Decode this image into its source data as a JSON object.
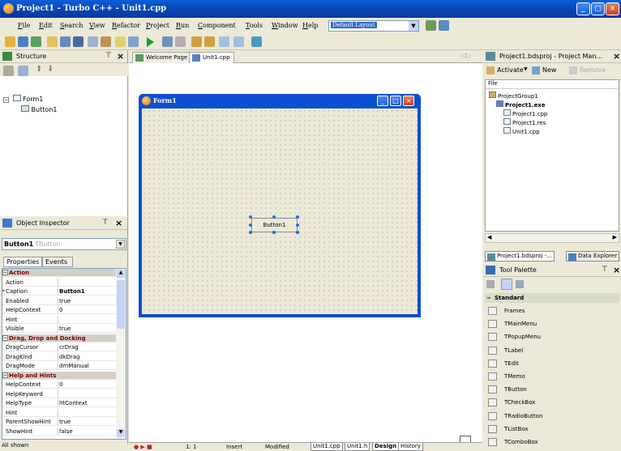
{
  "window": {
    "title": "Project1 - Turbo C++ - Unit1.cpp"
  },
  "menu": {
    "items": [
      "File",
      "Edit",
      "Search",
      "View",
      "Refactor",
      "Project",
      "Run",
      "Component",
      "Tools",
      "Window",
      "Help"
    ],
    "layout_value": "Default Layout"
  },
  "structure": {
    "title": "Structure",
    "tree": [
      {
        "label": "Form1"
      },
      {
        "label": "Button1"
      }
    ]
  },
  "inspector": {
    "title": "Object Inspector",
    "object_name": "Button1",
    "object_type": "TButton",
    "tabs": [
      "Properties",
      "Events"
    ],
    "rows": [
      {
        "name": "Action",
        "value": "",
        "category": true
      },
      {
        "name": "Action",
        "value": ""
      },
      {
        "name": "Caption",
        "value": "Button1",
        "selected": true
      },
      {
        "name": "Enabled",
        "value": "true"
      },
      {
        "name": "HelpContext",
        "value": "0"
      },
      {
        "name": "Hint",
        "value": ""
      },
      {
        "name": "Visible",
        "value": "true"
      },
      {
        "name": "Drag, Drop and Docking",
        "value": "",
        "category": true
      },
      {
        "name": "DragCursor",
        "value": "crDrag"
      },
      {
        "name": "DragKind",
        "value": "dkDrag"
      },
      {
        "name": "DragMode",
        "value": "dmManual"
      },
      {
        "name": "Help and Hints",
        "value": "",
        "category": true
      },
      {
        "name": "HelpContext",
        "value": "0"
      },
      {
        "name": "HelpKeyword",
        "value": ""
      },
      {
        "name": "HelpType",
        "value": "htContext"
      },
      {
        "name": "Hint",
        "value": ""
      },
      {
        "name": "ParentShowHint",
        "value": "true"
      },
      {
        "name": "ShowHint",
        "value": "false"
      }
    ],
    "status": "All shown"
  },
  "center": {
    "tabs": [
      {
        "label": "Welcome Page"
      },
      {
        "label": "Unit1.cpp",
        "active": true
      }
    ],
    "form_title": "Form1",
    "button_caption": "Button1",
    "status": {
      "position": "1:  1",
      "mode": "Insert",
      "modified": "Modified"
    },
    "bottom_tabs": [
      "Unit1.cpp",
      "Unit1.h",
      "Design",
      "History"
    ]
  },
  "project_manager": {
    "title": "Project1.bdsproj - Project Man...",
    "toolbar": {
      "activate": "Activate",
      "new": "New",
      "remove": "Remove"
    },
    "header": "File",
    "tree": [
      {
        "label": "ProjectGroup1",
        "level": 0
      },
      {
        "label": "Project1.exe",
        "level": 1,
        "bold": true
      },
      {
        "label": "Project1.cpp",
        "level": 2
      },
      {
        "label": "Project1.res",
        "level": 2
      },
      {
        "label": "Unit1.cpp",
        "level": 2
      }
    ],
    "bottom_tabs": [
      "Project1.bdsproj -...",
      "Data Explorer"
    ]
  },
  "palette": {
    "title": "Tool Palette",
    "category": "Standard",
    "items": [
      "Frames",
      "TMainMenu",
      "TPopupMenu",
      "TLabel",
      "TEdit",
      "TMemo",
      "TButton",
      "TCheckBox",
      "TRadioButton",
      "TListBox",
      "TComboBox"
    ]
  },
  "colors": {
    "titlebar": "#0842b0",
    "form_titlebar": "#0b50d0",
    "category_text": "#7f0000",
    "selection": "#316ac5"
  }
}
